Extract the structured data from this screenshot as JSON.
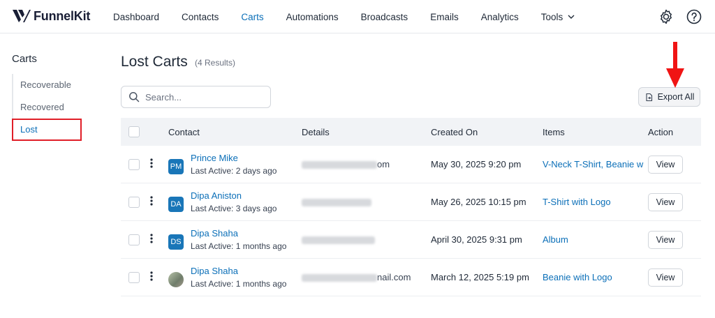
{
  "brand": {
    "name": "FunnelKit",
    "accent": "#0b6fb8",
    "logo_icon": "funnelkit-logo-icon"
  },
  "nav": {
    "items": [
      {
        "label": "Dashboard"
      },
      {
        "label": "Contacts"
      },
      {
        "label": "Carts",
        "active": true
      },
      {
        "label": "Automations"
      },
      {
        "label": "Broadcasts"
      },
      {
        "label": "Emails"
      },
      {
        "label": "Analytics"
      },
      {
        "label": "Tools"
      }
    ],
    "icons": [
      "gear-icon",
      "help-icon"
    ]
  },
  "sidebar": {
    "title": "Carts",
    "items": [
      {
        "label": "Recoverable"
      },
      {
        "label": "Recovered"
      },
      {
        "label": "Lost",
        "active": true
      }
    ]
  },
  "page": {
    "title": "Lost Carts",
    "results": "(4 Results)",
    "search_placeholder": "Search...",
    "export_label": "Export All"
  },
  "table": {
    "columns": [
      "Contact",
      "Details",
      "Created On",
      "Items",
      "Action"
    ],
    "rows": [
      {
        "initials": "PM",
        "name": "Prince Mike",
        "last_active": "Last Active: 2 days ago",
        "details_suffix": "om",
        "created": "May 30, 2025 9:20 pm",
        "items": "V-Neck T-Shirt, Beanie w",
        "action": "View"
      },
      {
        "initials": "DA",
        "name": "Dipa Aniston",
        "last_active": "Last Active: 3 days ago",
        "details_suffix": "",
        "created": "May 26, 2025 10:15 pm",
        "items": "T-Shirt with Logo",
        "action": "View"
      },
      {
        "initials": "DS",
        "name": "Dipa Shaha",
        "last_active": "Last Active: 1 months ago",
        "details_suffix": "",
        "created": "April 30, 2025 9:31 pm",
        "items": "Album",
        "action": "View"
      },
      {
        "initials": "",
        "name": "Dipa Shaha",
        "last_active": "Last Active: 1 months ago",
        "details_suffix": "nail.com",
        "created": "March 12, 2025 5:19 pm",
        "items": "Beanie with Logo",
        "action": "View"
      }
    ]
  }
}
